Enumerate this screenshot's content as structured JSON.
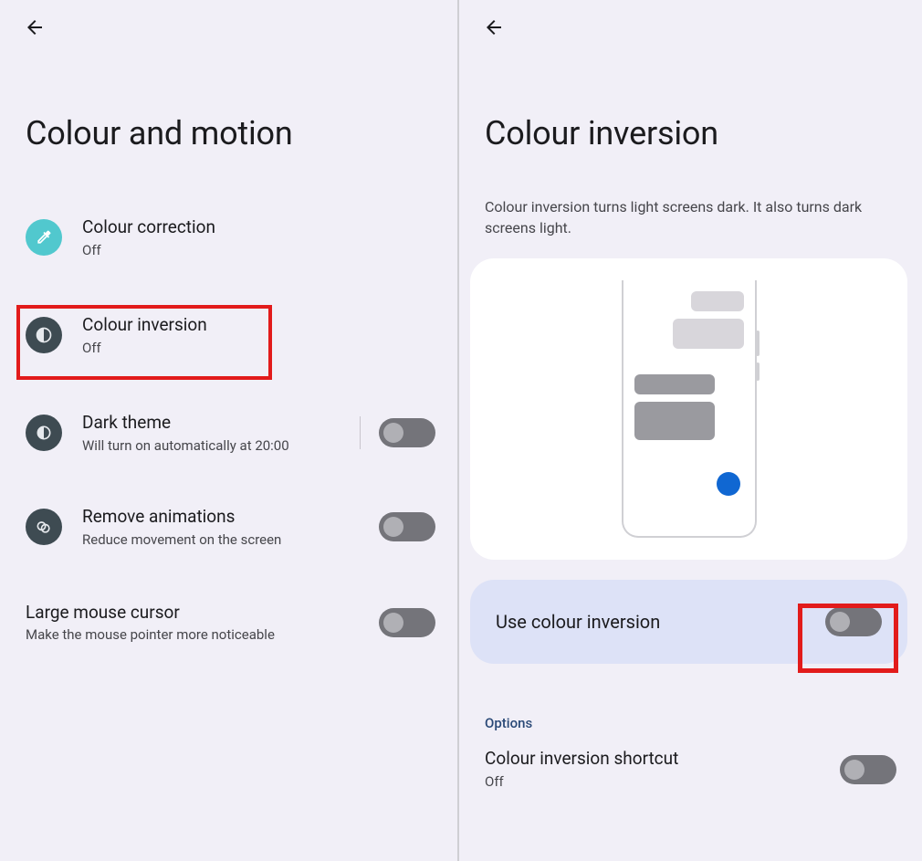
{
  "left": {
    "title": "Colour and motion",
    "items": {
      "colour_correction": {
        "title": "Colour correction",
        "sub": "Off"
      },
      "colour_inversion": {
        "title": "Colour inversion",
        "sub": "Off"
      },
      "dark_theme": {
        "title": "Dark theme",
        "sub": "Will turn on automatically at 20:00"
      },
      "remove_animations": {
        "title": "Remove animations",
        "sub": "Reduce movement on the screen"
      },
      "large_cursor": {
        "title": "Large mouse cursor",
        "sub": "Make the mouse pointer more noticeable"
      }
    }
  },
  "right": {
    "title": "Colour inversion",
    "description": "Colour inversion turns light screens dark. It also turns dark screens light.",
    "use_label": "Use colour inversion",
    "options_label": "Options",
    "shortcut": {
      "title": "Colour inversion shortcut",
      "sub": "Off"
    }
  }
}
